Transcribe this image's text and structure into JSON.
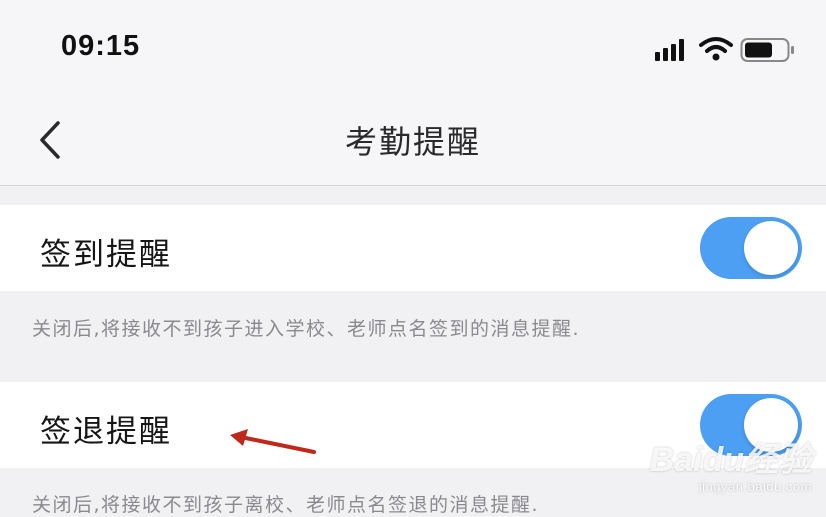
{
  "status_bar": {
    "time": "09:15",
    "icons": [
      "signal-icon",
      "wifi-icon",
      "battery-icon"
    ]
  },
  "nav": {
    "title": "考勤提醒",
    "back_icon": "chevron-left-icon"
  },
  "settings": [
    {
      "label": "签到提醒",
      "enabled": true,
      "hint": "关闭后,将接收不到孩子进入学校、老师点名签到的消息提醒."
    },
    {
      "label": "签退提醒",
      "enabled": true,
      "hint": "关闭后,将接收不到孩子离校、老师点名签退的消息提醒."
    }
  ],
  "watermark": {
    "brand": "Baidu经验",
    "url": "jingyan.baidu.com"
  },
  "colors": {
    "accent": "#4c9ff2",
    "annotation_arrow": "#c0281c"
  }
}
